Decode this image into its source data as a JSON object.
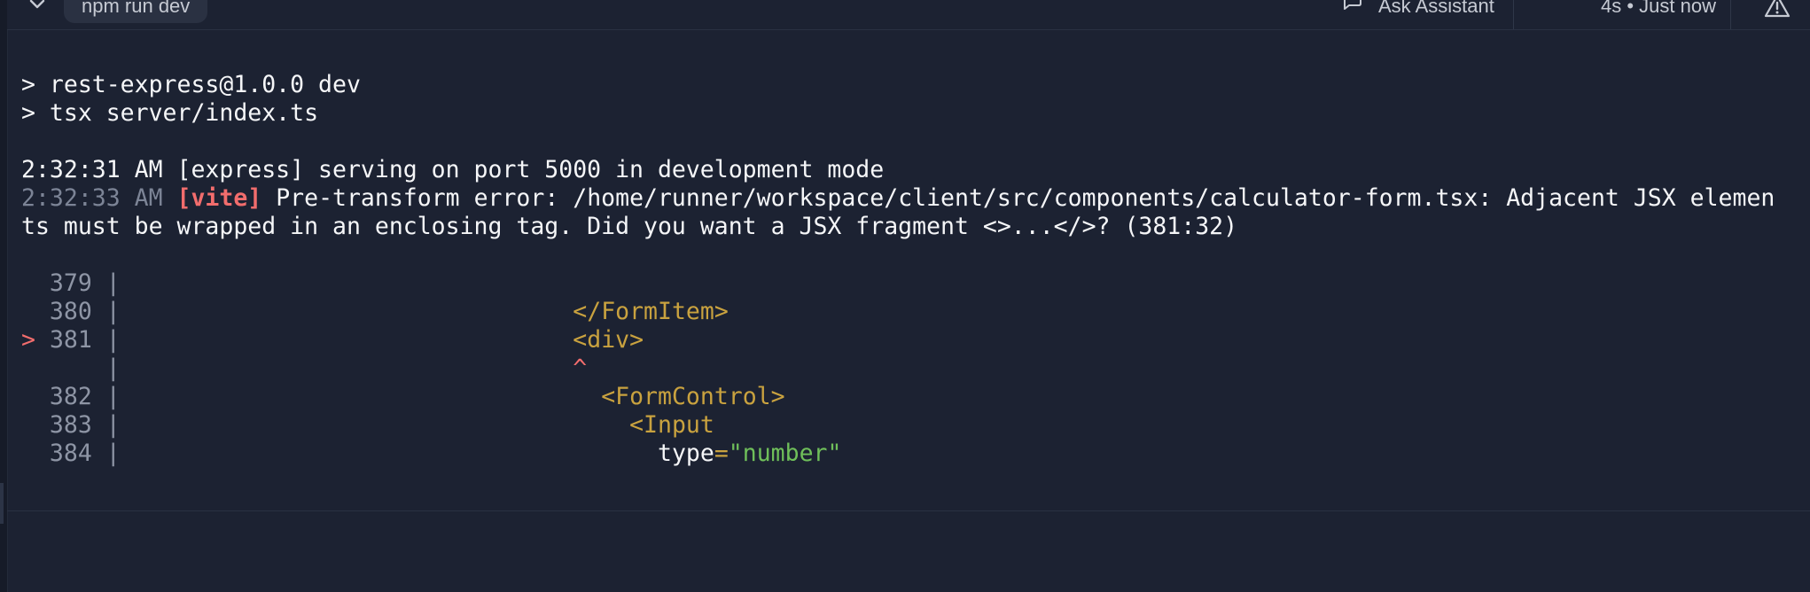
{
  "header": {
    "command_label": "npm run dev",
    "ask_assistant_label": "Ask Assistant",
    "status_text": "4s • Just now"
  },
  "terminal": {
    "script_line1": "> rest-express@1.0.0 dev",
    "script_line2": "> tsx server/index.ts",
    "log1_text": "2:32:31 AM [express] serving on port 5000 in development mode",
    "log2_time": "2:32:33 AM",
    "log2_tag": "[vite]",
    "log2_msg_part1": " Pre-transform error: /home/runner/workspace/client/src/components/calculator-form.tsx: Adjacent JSX elemen",
    "log2_msg_part2": "ts must be wrapped in an enclosing tag. Did you want a JSX fragment <>...</>? (381:32)",
    "code": {
      "l379_num": "379",
      "l380_num": "380",
      "l380_code": "</FormItem>",
      "l381_marker": ">",
      "l381_num": "381",
      "l381_code": "<div>",
      "caret": "^",
      "l382_num": "382",
      "l382_code": "<FormControl>",
      "l383_num": "383",
      "l383_code": "<Input",
      "l384_num": "384",
      "l384_attr": "type",
      "l384_eq": "=",
      "l384_str": "\"number\"",
      "gutter": "|"
    }
  },
  "colors": {
    "background": "#1c2232",
    "error_red": "#f26d6d",
    "jsx_tag": "#c9a23f",
    "string_green": "#6fbf5a"
  },
  "icons": {
    "chevron": "chevron-down-icon",
    "assistant": "chat-bubble-icon",
    "warning": "warning-triangle-icon"
  }
}
